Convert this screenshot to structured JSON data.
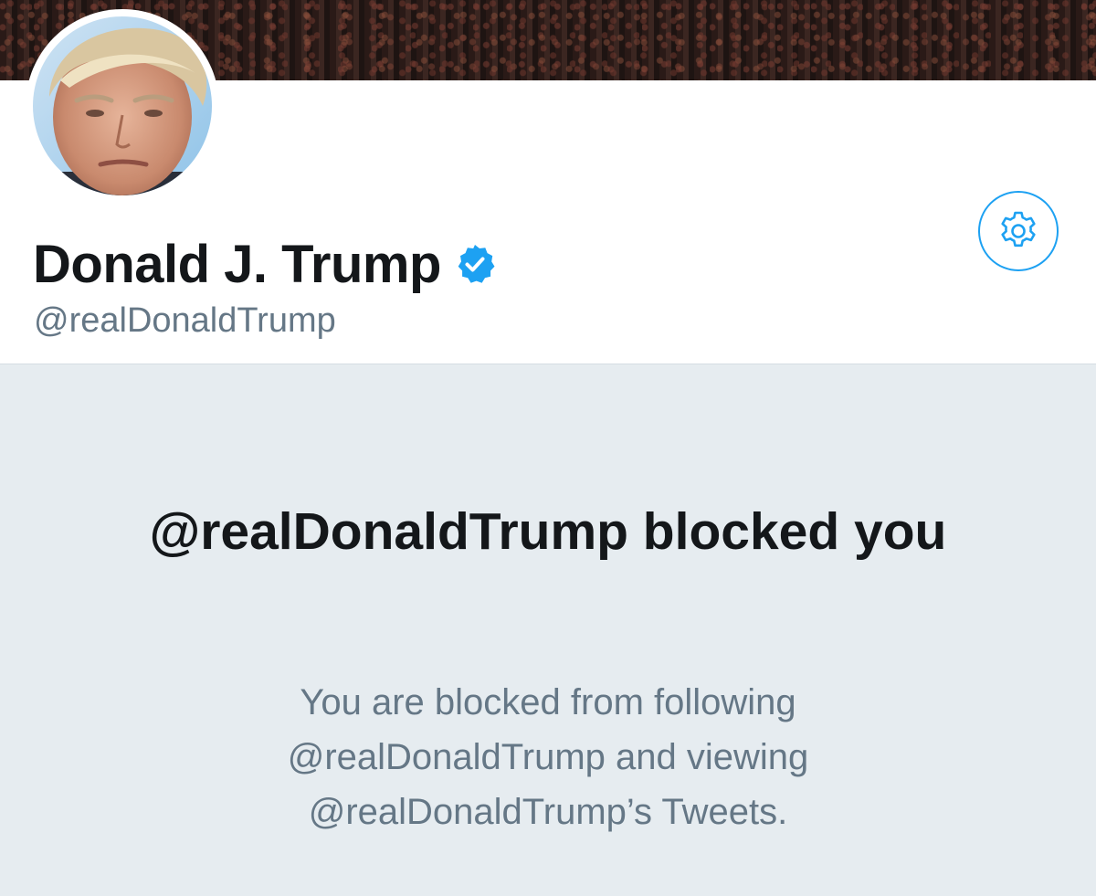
{
  "profile": {
    "display_name": "Donald J. Trump",
    "handle": "@realDonaldTrump",
    "verified": true
  },
  "icons": {
    "settings": "gear-icon",
    "verified": "verified-badge-icon"
  },
  "blocked": {
    "title": "@realDonaldTrump blocked you",
    "description": "You are blocked from following @realDonaldTrump and viewing @realDonaldTrump’s Tweets."
  },
  "colors": {
    "accent": "#1da1f2",
    "text_primary": "#14171a",
    "text_secondary": "#657786",
    "blocked_background": "#e6ecf0"
  }
}
